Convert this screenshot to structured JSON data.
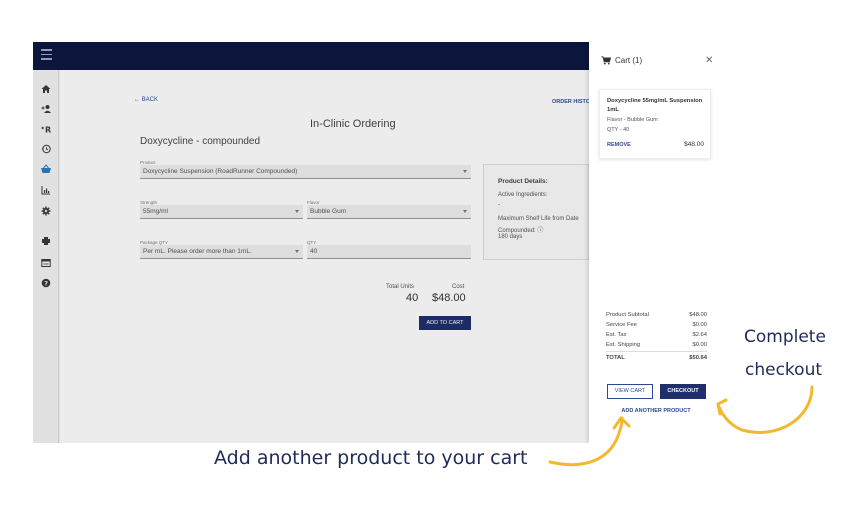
{
  "app": {
    "back_label": "← BACK",
    "order_history_label": "ORDER HISTO",
    "page_title": "In-Clinic Ordering",
    "product_title": "Doxycycline - compounded"
  },
  "sidebar": {
    "items": [
      {
        "icon": "home-icon"
      },
      {
        "icon": "add-client-icon"
      },
      {
        "icon": "prescription-icon"
      },
      {
        "icon": "history-icon"
      },
      {
        "icon": "basket-icon",
        "active": true
      },
      {
        "icon": "reports-icon"
      },
      {
        "icon": "settings-icon"
      },
      {
        "icon": "printer-icon"
      },
      {
        "icon": "billing-icon"
      },
      {
        "icon": "help-icon"
      }
    ]
  },
  "form": {
    "product": {
      "label": "Product",
      "value": "Doxycycline Suspension (RoadRunner Compounded)"
    },
    "strength": {
      "label": "Strength",
      "value": "55mg/ml"
    },
    "flavor": {
      "label": "Flavor",
      "value": "Bubble Gum"
    },
    "package_qty": {
      "label": "Package QTY",
      "value": "Per mL. Please order more than 1mL."
    },
    "qty": {
      "label": "QTY",
      "value": "40"
    }
  },
  "details": {
    "heading": "Product Details:",
    "active_ingredients_label": "Active Ingredients:",
    "active_ingredients_value": "-",
    "shelf_life_label": "Maximum Shelf Life from Date",
    "shelf_life_label_2": "Compounded: ⓘ",
    "shelf_life_value": "180 days"
  },
  "totals": {
    "units_label": "Total Units",
    "units_value": "40",
    "cost_label": "Cost",
    "cost_value": "$48.00",
    "add_to_cart_label": "ADD TO CART"
  },
  "cart": {
    "title": "Cart (1)",
    "item": {
      "name": "Doxycycline 55mg/mL Suspension 1mL",
      "flavor": "Flavor - Bubble Gum",
      "qty": "QTY - 40",
      "remove_label": "REMOVE",
      "price": "$48.00"
    },
    "summary": [
      {
        "label": "Product Subtotal",
        "value": "$48.00"
      },
      {
        "label": "Service Fee",
        "value": "$0.00"
      },
      {
        "label": "Est. Tax",
        "value": "$2.64"
      },
      {
        "label": "Est. Shipping",
        "value": "$0.00"
      }
    ],
    "total_label": "TOTAL",
    "total_value": "$50.64",
    "view_cart_label": "VIEW CART",
    "checkout_label": "CHECKOUT",
    "add_another_label": "ADD ANOTHER PRODUCT"
  },
  "annotations": {
    "complete_line1": "Complete",
    "complete_line2": "checkout",
    "add_product": "Add another product to your cart"
  },
  "colors": {
    "topbar": "#0d1740",
    "primary_button": "#1f2f6b",
    "link": "#2d4a90",
    "arrow": "#f4b82e",
    "annotation_text": "#1f2a5a"
  }
}
